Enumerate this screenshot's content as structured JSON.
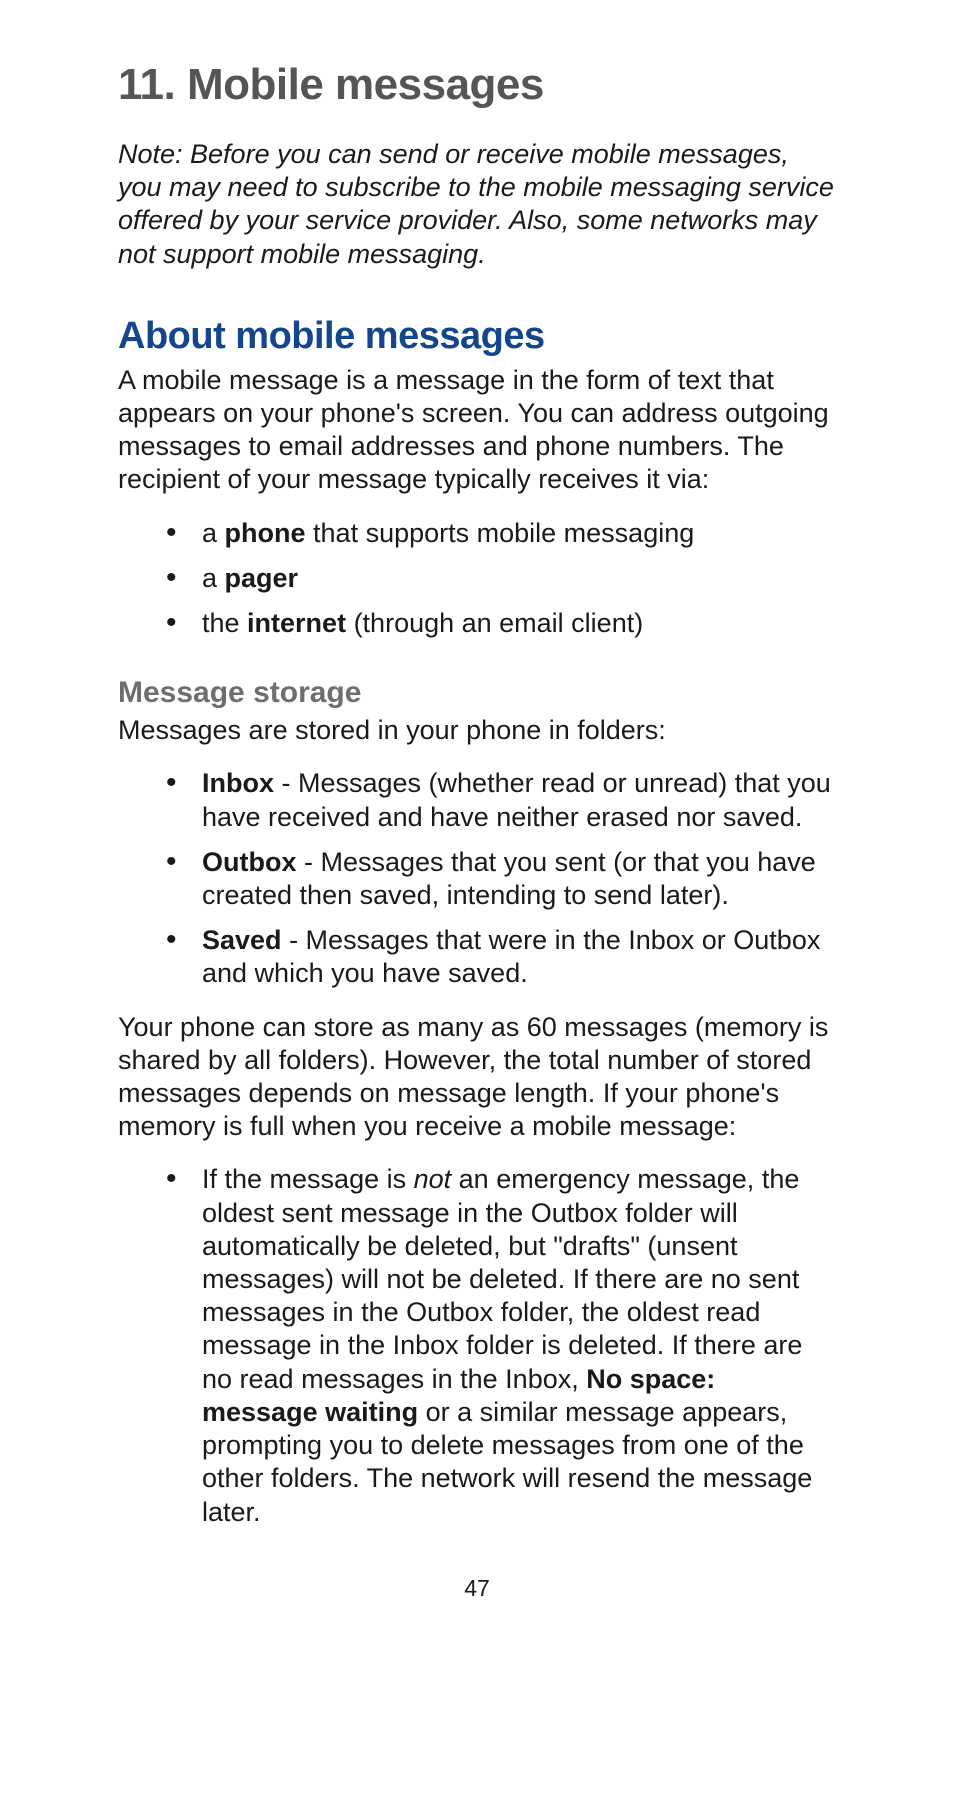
{
  "chapter": {
    "number": "11.",
    "title": "Mobile messages"
  },
  "note": "Note: Before you can send or receive mobile messages, you may need to subscribe to the mobile messaging service offered by your service provider. Also, some networks may not support mobile messaging.",
  "section1": {
    "title": "About mobile messages",
    "intro": "A mobile message is a message in the form of text that appears on your phone's screen. You can address outgoing messages to email addresses and phone numbers. The recipient of your message typically receives it via:",
    "bullets": [
      {
        "pre": "a ",
        "bold": "phone",
        "post": " that supports mobile messaging"
      },
      {
        "pre": "a ",
        "bold": "pager",
        "post": ""
      },
      {
        "pre": "the ",
        "bold": "internet",
        "post": " (through an email client)"
      }
    ]
  },
  "section2": {
    "subheading": "Message storage",
    "intro": "Messages are stored in your phone in folders:",
    "bullets": [
      {
        "bold": "Inbox",
        "post": " - Messages (whether read or unread) that you have received and have neither erased nor saved."
      },
      {
        "bold": "Outbox",
        "post": " - Messages that you sent (or that you have created then saved, intending to send later)."
      },
      {
        "bold": "Saved",
        "post": " - Messages that were in the Inbox or Outbox and which you have saved."
      }
    ],
    "para2": "Your phone can store as many as 60 messages (memory is shared by all folders). However, the total number of stored messages depends on message length. If your phone's memory is full when you receive a mobile message:",
    "memory_bullet": {
      "pre": "If the message is ",
      "italic": "not",
      "mid": " an emergency message, the oldest sent message in the Outbox folder will automatically be deleted, but \"drafts\" (unsent messages) will not be deleted. If there are no sent messages in the Outbox folder, the oldest read message in the Inbox folder is deleted. If there are no read messages in the Inbox, ",
      "bold": "No space: message waiting",
      "post": " or a similar message appears, prompting you to delete messages from one of the other folders. The network will resend the message later."
    }
  },
  "pageNumber": "47"
}
